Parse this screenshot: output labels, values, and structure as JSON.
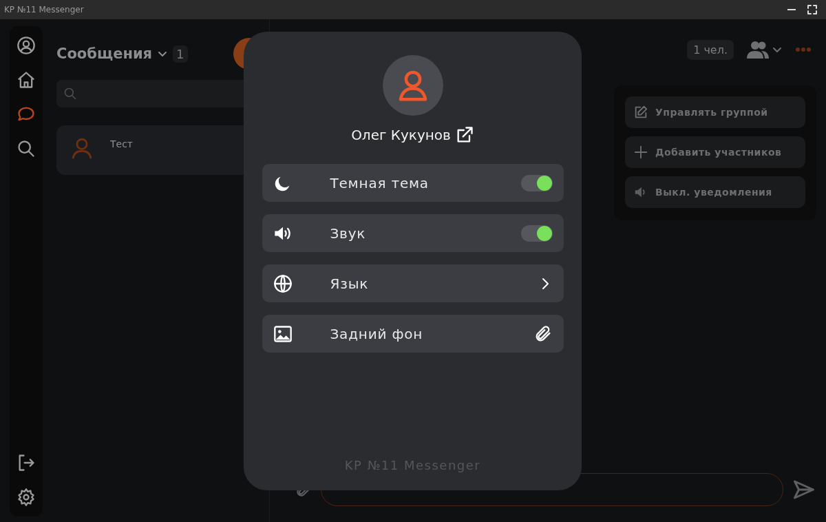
{
  "window": {
    "title": "KP №11 Messenger"
  },
  "nav": {
    "items": [
      {
        "kind": "profile",
        "selected": false
      },
      {
        "kind": "home",
        "selected": false
      },
      {
        "kind": "chats",
        "selected": true
      },
      {
        "kind": "search",
        "selected": false
      }
    ],
    "bottom": [
      {
        "kind": "logout",
        "selected": false
      },
      {
        "kind": "settings",
        "selected": false
      }
    ]
  },
  "chat_list": {
    "title": "Сообщения",
    "count": "1",
    "chats": [
      {
        "name": "Тест"
      }
    ]
  },
  "chat_header": {
    "members": "1 чел."
  },
  "group_menu": [
    {
      "kind": "edit",
      "label": "Управлять группой"
    },
    {
      "kind": "add",
      "label": "Добавить участников"
    },
    {
      "kind": "mute",
      "label": "Выкл. уведомления"
    }
  ],
  "profile": {
    "name": "Олег Кукунов",
    "settings": [
      {
        "kind": "theme",
        "label": "Темная тема",
        "on": true
      },
      {
        "kind": "sound",
        "label": "Звук",
        "on": true
      },
      {
        "kind": "language",
        "label": "Язык"
      },
      {
        "kind": "background",
        "label": "Задний фон"
      }
    ],
    "footer": "KP №11 Messenger"
  }
}
